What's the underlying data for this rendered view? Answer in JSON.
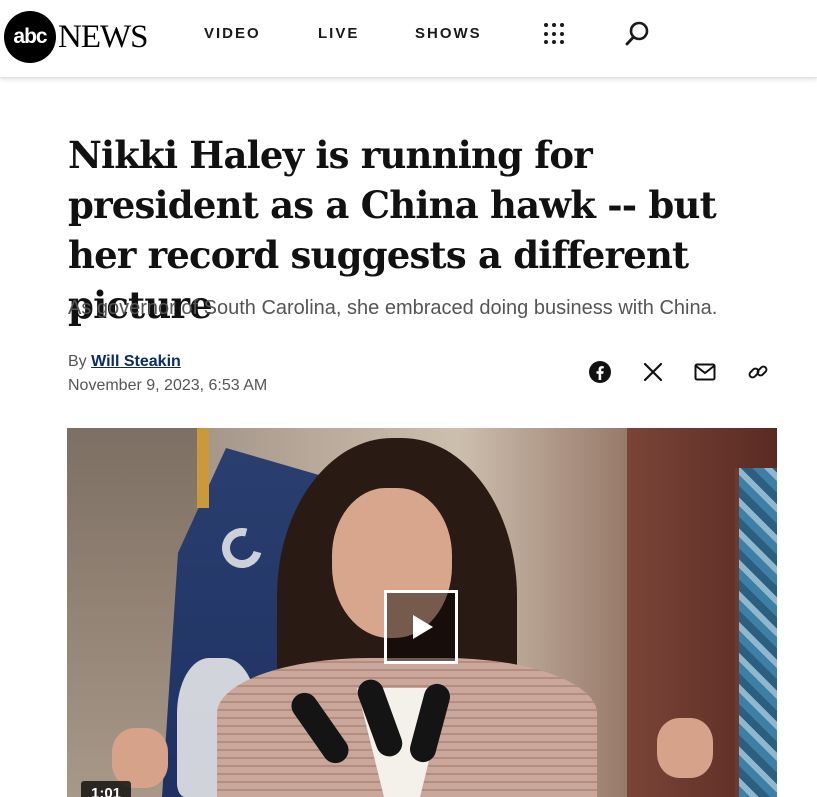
{
  "header": {
    "logo_mark": "abc",
    "logo_word": "NEWS",
    "nav": [
      "VIDEO",
      "LIVE",
      "SHOWS"
    ],
    "icons": [
      "grid-menu-icon",
      "search-icon"
    ]
  },
  "article": {
    "headline": "Nikki Haley is running for president as a China hawk -- but her record suggests a different picture",
    "dek": "As governor of South Carolina, she embraced doing business with China.",
    "byline_prefix": "By",
    "author": "Will Steakin",
    "date": "November 9, 2023, 6:53 AM",
    "share_icons": [
      "facebook-icon",
      "x-icon",
      "email-icon",
      "link-icon"
    ]
  },
  "video": {
    "duration": "1:01"
  },
  "colors": {
    "author_link": "#0a2a6b",
    "text_muted": "#555555"
  }
}
